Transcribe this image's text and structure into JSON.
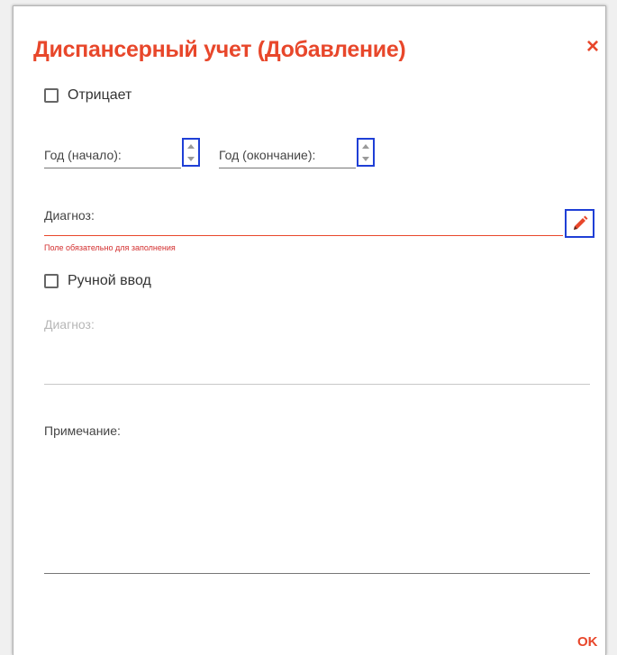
{
  "dialog": {
    "title": "Диспансерный учет (Добавление)",
    "close_icon": "close-icon",
    "accent_color": "#e8472b",
    "ok_label": "OK"
  },
  "denies": {
    "label": "Отрицает",
    "checked": false
  },
  "year_start": {
    "label": "Год (начало):",
    "value": ""
  },
  "year_end": {
    "label": "Год (окончание):",
    "value": ""
  },
  "diagnosis": {
    "label": "Диагноз:",
    "value": "",
    "error": "Поле обязательно для заполнения",
    "edit_icon": "pencil-icon"
  },
  "manual_entry": {
    "label": "Ручной ввод",
    "checked": false
  },
  "manual_diagnosis": {
    "label": "Диагноз:",
    "value": ""
  },
  "note": {
    "label": "Примечание:",
    "value": ""
  },
  "highlight_color": "#1f3fd6",
  "error_color": "#d32f2f"
}
